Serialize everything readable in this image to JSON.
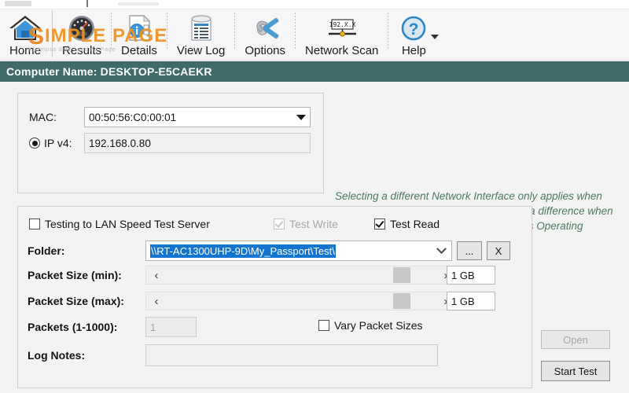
{
  "window": {
    "computer_name_bar": "Computer Name: DESKTOP-E5CAEKR"
  },
  "ribbon": {
    "items": [
      {
        "label": "Home",
        "icon": "home-icon"
      },
      {
        "label": "Results",
        "icon": "gauge-icon"
      },
      {
        "label": "Details",
        "icon": "document-info-icon"
      },
      {
        "label": "View Log",
        "icon": "log-scroll-icon"
      },
      {
        "label": "Options",
        "icon": "hammer-wrench-icon"
      },
      {
        "label": "Network Scan",
        "icon": "network-scan-icon",
        "icon_text": "192.X.X"
      },
      {
        "label": "Help",
        "icon": "question-circle-icon",
        "has_dropdown": true
      }
    ]
  },
  "interface_panel": {
    "mac_label": "MAC:",
    "mac_value": "00:50:56:C0:00:01",
    "ipv4_label": "IP v4:",
    "ipv4_value": "192.168.0.80",
    "ipv4_selected": true
  },
  "help_text": "Selecting a different Network Interface only applies when testing to LST Server.  It does NOT make a difference when testing to a shared folder.  Your computer's Operating System chooses it automatically.",
  "test_panel": {
    "testing_to_server": {
      "label": "Testing to LAN Speed Test Server",
      "checked": false,
      "enabled": true
    },
    "test_write": {
      "label": "Test Write",
      "checked": true,
      "enabled": false
    },
    "test_read": {
      "label": "Test Read",
      "checked": true,
      "enabled": true
    },
    "folder_label": "Folder:",
    "folder_value": "\\\\RT-AC1300UHP-9D\\My_Passport\\Test\\",
    "folder_value_selected": true,
    "browse_button": "...",
    "clear_button": "X",
    "packet_min_label": "Packet Size (min):",
    "packet_min_value": "1 GB",
    "packet_min_left_arrow": "‹",
    "packet_min_right_arrow": "›",
    "packet_max_label": "Packet Size (max):",
    "packet_max_value": "1 GB",
    "packet_max_left_arrow": "‹",
    "packet_max_right_arrow": "›",
    "packets_label": "Packets (1-1000):",
    "packets_value": "1",
    "packets_enabled": false,
    "vary_packet_sizes": {
      "label": "Vary Packet Sizes",
      "checked": false
    },
    "log_notes_label": "Log Notes:",
    "log_notes_value": ""
  },
  "actions": {
    "open_button": "Open",
    "open_enabled": false,
    "start_test_button": "Start Test",
    "start_test_enabled": true
  },
  "watermark": {
    "main": "IMPLE PAGE",
    "initial": "S",
    "sub": "Khompsa dide Landing Page"
  },
  "colors": {
    "title_bar": "#3f6b6b",
    "help_text": "#4b7a5e",
    "selection_blue": "#1475d1",
    "watermark_orange": "#f0921e"
  }
}
